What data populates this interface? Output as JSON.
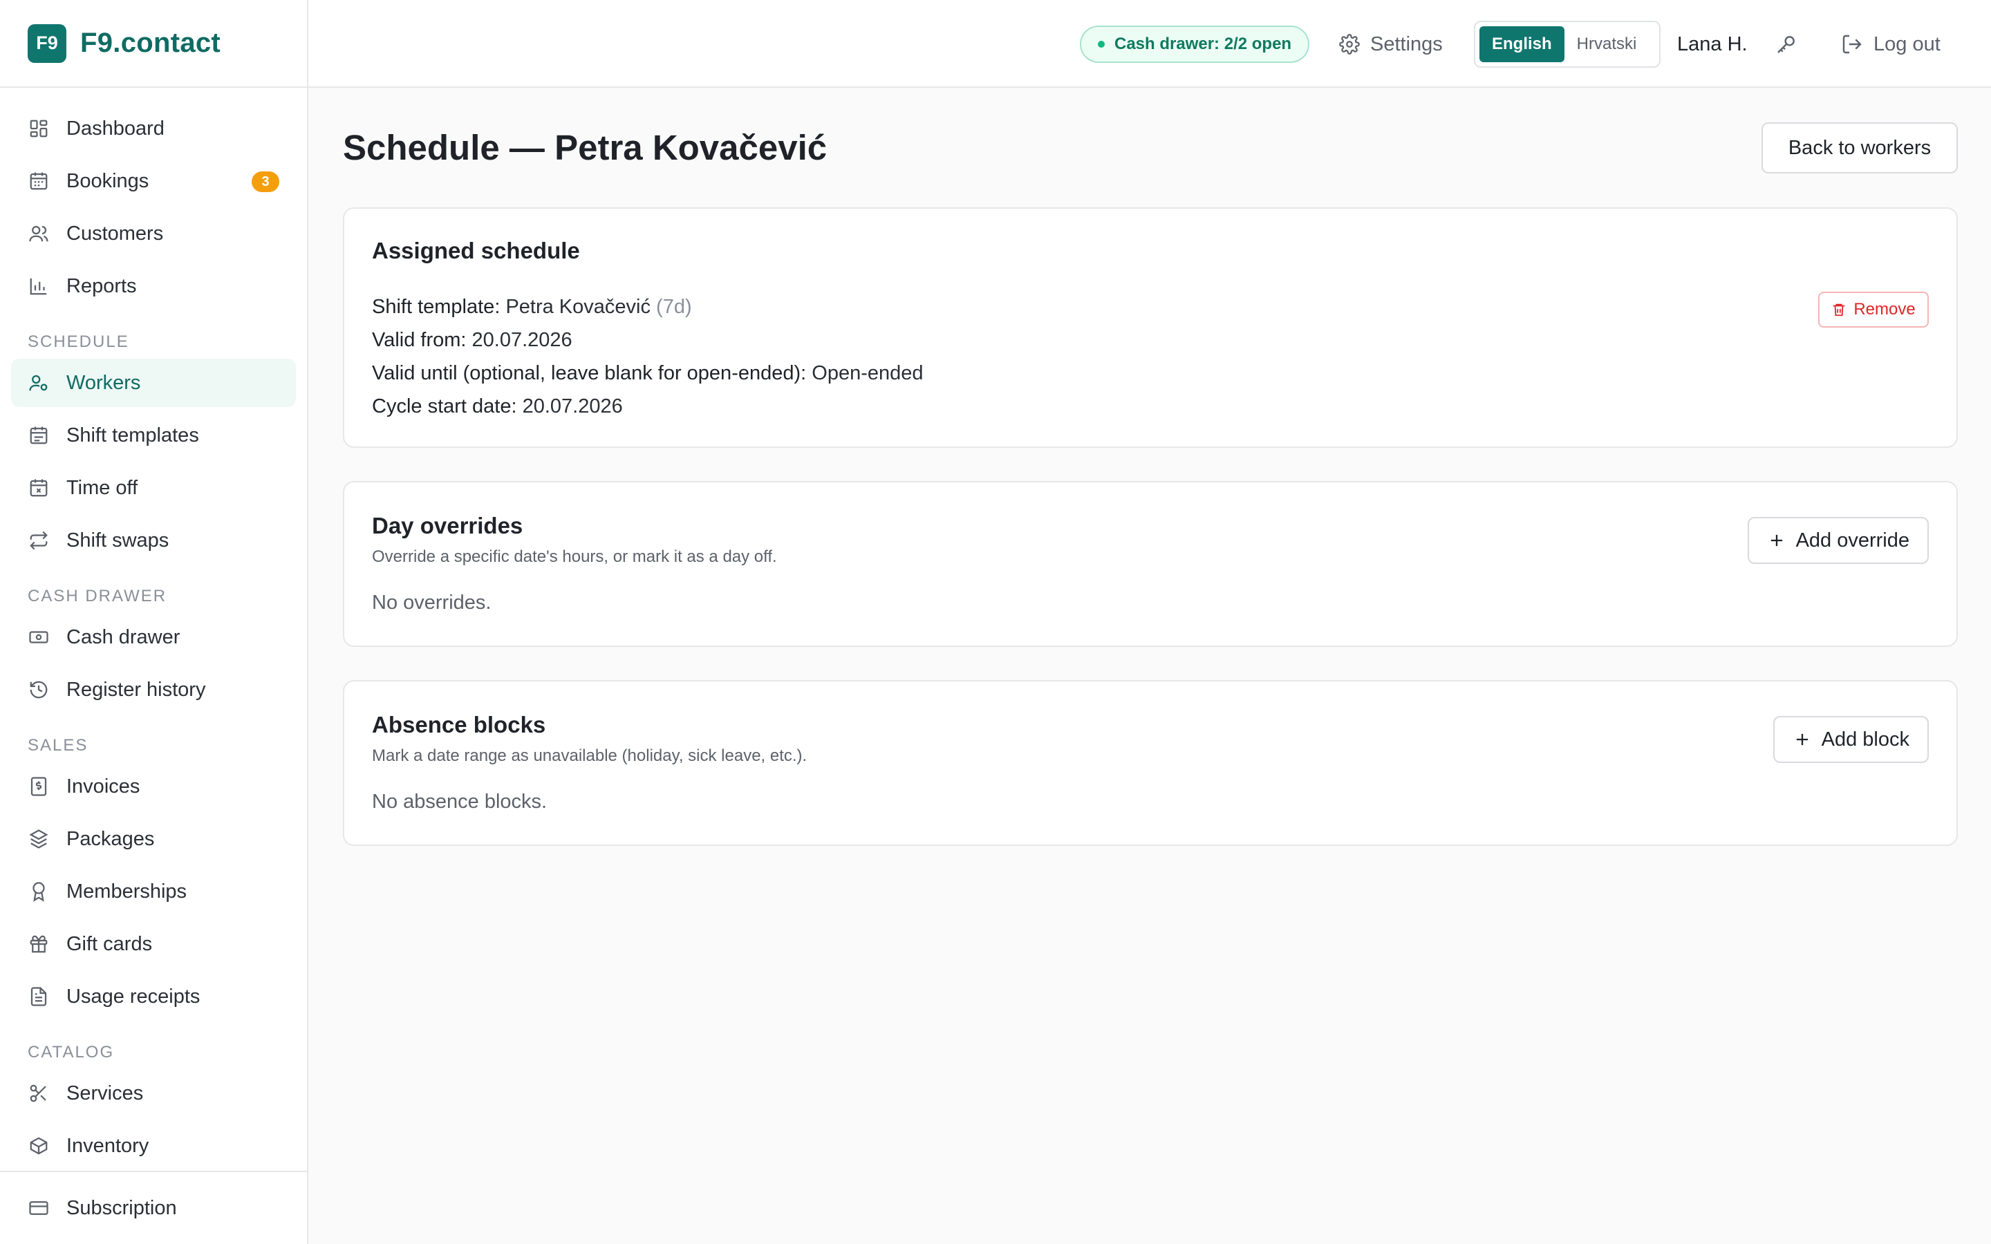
{
  "brand": {
    "logo_text": "F9",
    "name": "F9.contact"
  },
  "header": {
    "cash_status": "Cash drawer: 2/2 open",
    "settings_label": "Settings",
    "languages": [
      {
        "label": "English",
        "active": true
      },
      {
        "label": "Hrvatski",
        "active": false
      }
    ],
    "user": "Lana H.",
    "logout_label": "Log out"
  },
  "sidebar": {
    "top_items": [
      {
        "label": "Dashboard",
        "icon": "dashboard-icon"
      },
      {
        "label": "Bookings",
        "icon": "calendar-icon",
        "badge": "3"
      },
      {
        "label": "Customers",
        "icon": "users-icon"
      },
      {
        "label": "Reports",
        "icon": "bar-chart-icon"
      }
    ],
    "sections": [
      {
        "title": "SCHEDULE",
        "items": [
          {
            "label": "Workers",
            "icon": "user-cog-icon",
            "active": true
          },
          {
            "label": "Shift templates",
            "icon": "calendar-grid-icon"
          },
          {
            "label": "Time off",
            "icon": "calendar-x-icon"
          },
          {
            "label": "Shift swaps",
            "icon": "repeat-icon"
          }
        ]
      },
      {
        "title": "CASH DRAWER",
        "items": [
          {
            "label": "Cash drawer",
            "icon": "banknote-icon"
          },
          {
            "label": "Register history",
            "icon": "history-icon"
          }
        ]
      },
      {
        "title": "SALES",
        "items": [
          {
            "label": "Invoices",
            "icon": "receipt-dollar-icon"
          },
          {
            "label": "Packages",
            "icon": "package-stack-icon"
          },
          {
            "label": "Memberships",
            "icon": "award-icon"
          },
          {
            "label": "Gift cards",
            "icon": "gift-icon"
          },
          {
            "label": "Usage receipts",
            "icon": "file-text-icon"
          }
        ]
      },
      {
        "title": "CATALOG",
        "items": [
          {
            "label": "Services",
            "icon": "scissors-icon"
          },
          {
            "label": "Inventory",
            "icon": "box-icon"
          }
        ]
      }
    ],
    "footer_item": {
      "label": "Subscription",
      "icon": "credit-card-icon"
    }
  },
  "page": {
    "title": "Schedule — Petra Kovačević",
    "back_label": "Back to workers"
  },
  "assigned": {
    "title": "Assigned schedule",
    "shift_template_label": "Shift template:",
    "shift_template_value": "Petra Kovačević",
    "shift_template_cycle": "(7d)",
    "valid_from_label": "Valid from:",
    "valid_from_value": "20.07.2026",
    "valid_until_label": "Valid until (optional, leave blank for open-ended):",
    "valid_until_value": "Open-ended",
    "cycle_start_label": "Cycle start date:",
    "cycle_start_value": "20.07.2026",
    "remove_label": "Remove"
  },
  "overrides": {
    "title": "Day overrides",
    "subtitle": "Override a specific date's hours, or mark it as a day off.",
    "add_label": "Add override",
    "empty": "No overrides."
  },
  "absence": {
    "title": "Absence blocks",
    "subtitle": "Mark a date range as unavailable (holiday, sick leave, etc.).",
    "add_label": "Add block",
    "empty": "No absence blocks."
  }
}
